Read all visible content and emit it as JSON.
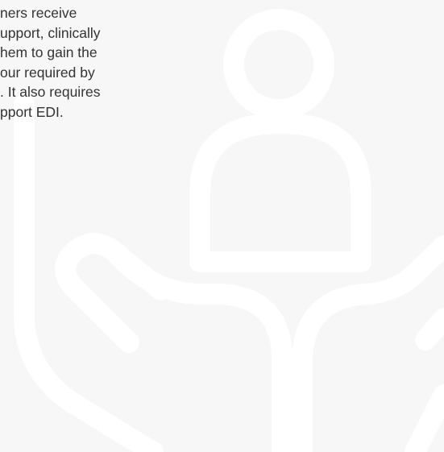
{
  "document": {
    "paragraph": "ners receive\nupport, clinically\nhem to gain the\nour required by\n. It also requires\npport EDI."
  },
  "colors": {
    "background": "#f7f7f7",
    "illustration": "#ffffff",
    "text": "#333333"
  },
  "icons": {
    "background_illustration": "person-supported-by-hands-icon"
  }
}
